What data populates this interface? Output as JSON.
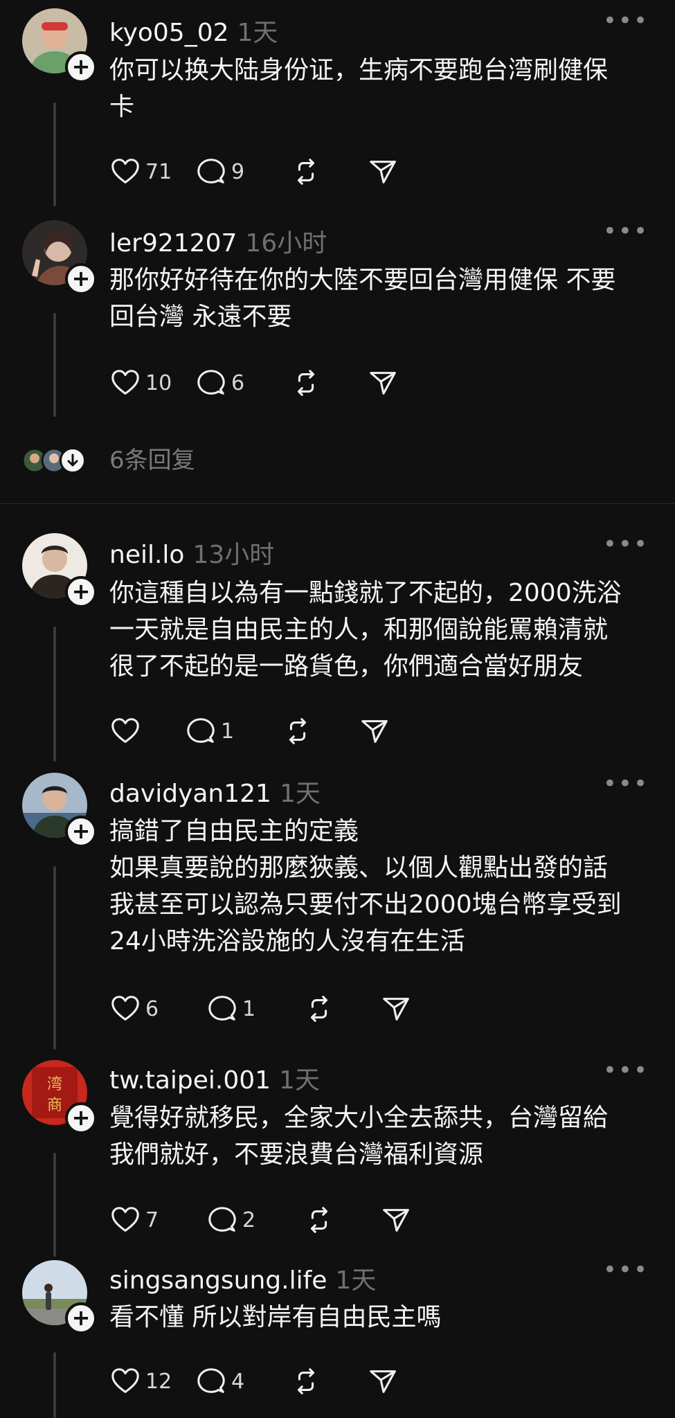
{
  "posts": [
    {
      "username": "kyo05_02",
      "time": "1天",
      "lines": [
        "你可以换大陆身份证，生病不要跑台湾刷健保",
        "卡"
      ],
      "likes": "71",
      "replies": "9",
      "more_icon": "more-icon",
      "avatar_colors": [
        "#c9bca7",
        "#6aa06a",
        "#d23a3a"
      ]
    },
    {
      "username": "ler921207",
      "time": "16小时",
      "lines": [
        "那你好好待在你的大陸不要回台灣用健保 不要",
        "回台灣 永遠不要"
      ],
      "likes": "10",
      "replies": "6",
      "avatar_colors": [
        "#2e2a2a",
        "#d8b9a8",
        "#7a4a3a"
      ]
    },
    {
      "username": "neil.lo",
      "time": "13小时",
      "lines": [
        "你這種自以為有一點錢就了不起的，2000洗浴",
        "一天就是自由民主的人，和那個說能罵賴清就",
        "很了不起的是一路貨色，你們適合當好朋友"
      ],
      "likes": "",
      "replies": "1",
      "avatar_colors": [
        "#efe9e4",
        "#2b2420",
        "#d8b8a0"
      ]
    },
    {
      "username": "davidyan121",
      "time": "1天",
      "lines": [
        "搞錯了自由民主的定義",
        "如果真要說的那麼狹義、以個人觀點出發的話",
        "我甚至可以認為只要付不出2000塊台幣享受到",
        "24小時洗浴設施的人沒有在生活"
      ],
      "likes": "6",
      "replies": "1",
      "avatar_colors": [
        "#a7b9c8",
        "#2a3a2a",
        "#d9b49a"
      ]
    },
    {
      "username": "tw.taipei.001",
      "time": "1天",
      "lines": [
        "覺得好就移民，全家大小全去舔共，台灣留給",
        "我們就好，不要浪費台灣福利資源"
      ],
      "likes": "7",
      "replies": "2",
      "avatar_colors": [
        "#c8281e",
        "#e8c060",
        "#a31a14"
      ]
    },
    {
      "username": "singsangsung.life",
      "time": "1天",
      "lines": [
        "看不懂 所以對岸有自由民主嗎"
      ],
      "likes": "12",
      "replies": "4",
      "avatar_colors": [
        "#cfdce8",
        "#7a8a5a",
        "#3a3a3a"
      ]
    }
  ],
  "reply_summary": {
    "label": "6条回复"
  },
  "icons": [
    "heart-icon",
    "comment-icon",
    "repost-icon",
    "share-icon",
    "more-icon",
    "follow-plus-icon",
    "chevron-down-icon"
  ]
}
